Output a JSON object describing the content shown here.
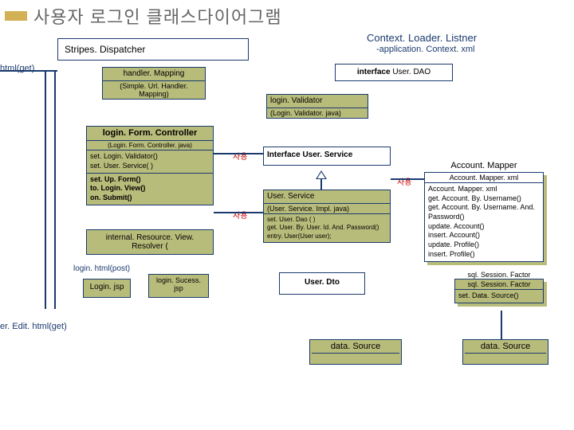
{
  "title": "사용자 로그인 클래스다이어그램",
  "contextLoader": {
    "title": "Context. Loader. Listner",
    "sub": "-application. Context. xml"
  },
  "stripesDispatcher": "Stripes. Dispatcher",
  "handlerMapping": {
    "title": "handler. Mapping",
    "sub": "(Simple. Url. Handler. Mapping)"
  },
  "loginHtmlGet": "html(get)",
  "interfaceUserDAO": "interface User. DAO",
  "interfaceLabel": "interface",
  "loginValidator": {
    "title": "login. Validator",
    "sub": "(Login. Validator. java)"
  },
  "loginFormController": {
    "title": "login. Form. Controller",
    "sub": "(Login. Form. Controller. java)",
    "ops1": [
      "set. Login. Validator()",
      "set. User. Service( )"
    ],
    "ops2": [
      "set. Up. Form()",
      "to. Login. View()",
      "on. Submit()"
    ]
  },
  "internalResourceViewResolver": "internal. Resource. View. Resolver (",
  "loginHtmlPost": "login. html(post)",
  "loginJsp": "Login. jsp",
  "loginSuccessJsp": "login. Sucess. jsp",
  "erEditGet": "er. Edit. html(get)",
  "interfaceUserService": "Interface User. Service",
  "userService": {
    "title": "User. Service",
    "sub": "(User. Service. Impl. java)",
    "ops": [
      "set. User. Dao ( )",
      "get. User. By. User. Id. And. Password()",
      "entry. User(User user);"
    ]
  },
  "userDto": "User. Dto",
  "accountMapper": {
    "title": "Account. Mapper",
    "sub": "Account. Mapper. xml",
    "ops": [
      "Account. Mapper. xml",
      "get. Account. By. Username()",
      "get. Account. By. Username. And. Password()",
      "update. Account()",
      "insert. Account()",
      "update. Profile()",
      "insert. Profile()"
    ]
  },
  "sqlSessionFactory": {
    "title": "sql. Session. Factor",
    "sub": "sql. Session. Factor",
    "ops": [
      "set. Data. Source()"
    ]
  },
  "dataSourceLeft": "data. Source",
  "dataSourceRight": "data. Source",
  "useLabel": "사용"
}
